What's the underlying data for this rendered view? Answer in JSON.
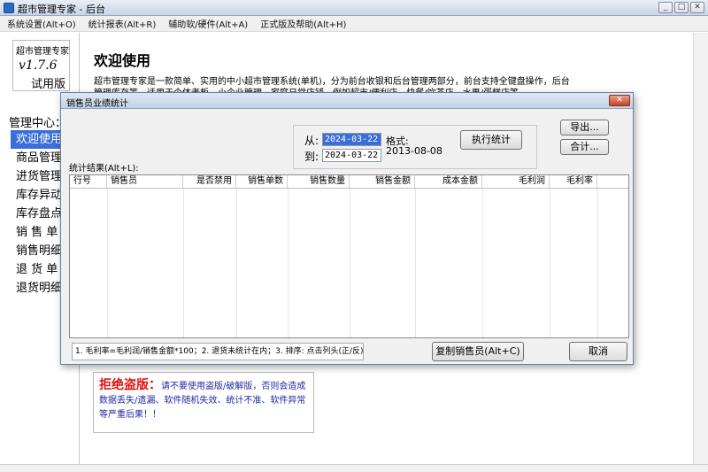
{
  "window": {
    "title": "超市管理专家 - 后台",
    "controls": [
      "_",
      "□",
      "✕"
    ]
  },
  "menu": [
    "系统设置(Alt+O)",
    "统计报表(Alt+R)",
    "辅助软/硬件(Alt+A)",
    "正式版及帮助(Alt+H)"
  ],
  "brand": {
    "name": "超市管理专家",
    "version": "v1.7.6",
    "trial": "试用版"
  },
  "nav": {
    "title": "管理中心：",
    "items": [
      "欢迎使用",
      "商品管理",
      "进货管理",
      "库存异动",
      "库存盘点",
      "销 售 单",
      "销售明细",
      "退 货 单",
      "退货明细"
    ],
    "active_index": 0
  },
  "content": {
    "title": "欢迎使用",
    "intro": "超市管理专家是一款简单、实用的中小超市管理系统(单机)，分为前台收银和后台管理两部分，前台支持全键盘操作，后台管理库存等，适用于个体老板、小企业管理、家庭日常店铺、例如超市/便利店、快餐/饮茶店、水果/蛋糕店等",
    "piracy_title": "拒绝盗版：",
    "piracy_text": "请不要使用盗版/破解版，否则会造成数据丢失/遗漏、软件随机失效、统计不准、软件异常等严重后果！！"
  },
  "dialog": {
    "title": "销售员业绩统计",
    "close": "✕",
    "from_label": "从:",
    "to_label": "到:",
    "from_value": "2024-03-22",
    "to_value": "2024-03-22",
    "format_label": "格式:",
    "format_value": "2013-08-08",
    "execute": "执行统计",
    "export": "导出...",
    "total": "合计...",
    "result_label": "统计结果(Alt+L):",
    "columns": [
      "行号",
      "销售员",
      "是否禁用",
      "销售单数",
      "销售数量",
      "销售金额",
      "成本金额",
      "毛利润",
      "毛利率"
    ],
    "note": "1. 毛利率=毛利润/销售金额*100；2. 退货未统计在内；3. 排序: 点击列头(正/反)",
    "copy": "复制销售员(Alt+C)",
    "cancel": "取消"
  },
  "colors": {
    "selection": "#3a6ed8",
    "warning_red": "#e01010",
    "warning_blue": "#1a2aa0"
  }
}
